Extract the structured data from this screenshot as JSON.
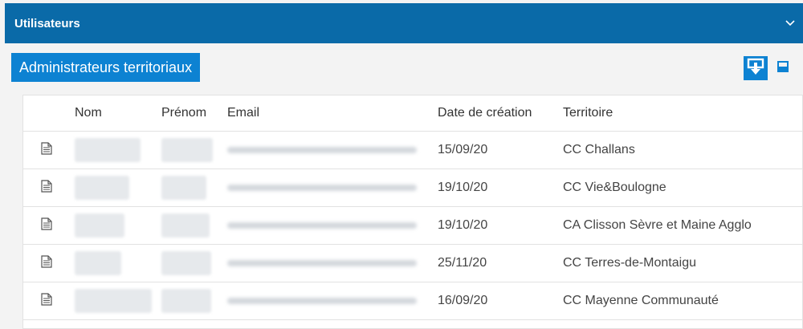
{
  "panel": {
    "title": "Utilisateurs"
  },
  "section": {
    "title": "Administrateurs territoriaux"
  },
  "table": {
    "headers": {
      "nom": "Nom",
      "prenom": "Prénom",
      "email": "Email",
      "date": "Date de création",
      "territoire": "Territoire"
    },
    "rows": [
      {
        "date": "15/09/20",
        "territoire": "CC Challans"
      },
      {
        "date": "19/10/20",
        "territoire": "CC Vie&Boulogne"
      },
      {
        "date": "19/10/20",
        "territoire": "CA Clisson Sèvre et Maine Agglo"
      },
      {
        "date": "25/11/20",
        "territoire": "CC Terres-de-Montaigu"
      },
      {
        "date": "16/09/20",
        "territoire": "CC Mayenne Communauté"
      }
    ]
  },
  "icons": {
    "chevron": "chevron-down-icon",
    "export": "export-download-icon",
    "collapse": "window-collapse-icon",
    "row": "document-icon"
  },
  "colors": {
    "header_bg": "#0a6aa8",
    "accent": "#0d82d2",
    "background": "#f3f3f3"
  }
}
